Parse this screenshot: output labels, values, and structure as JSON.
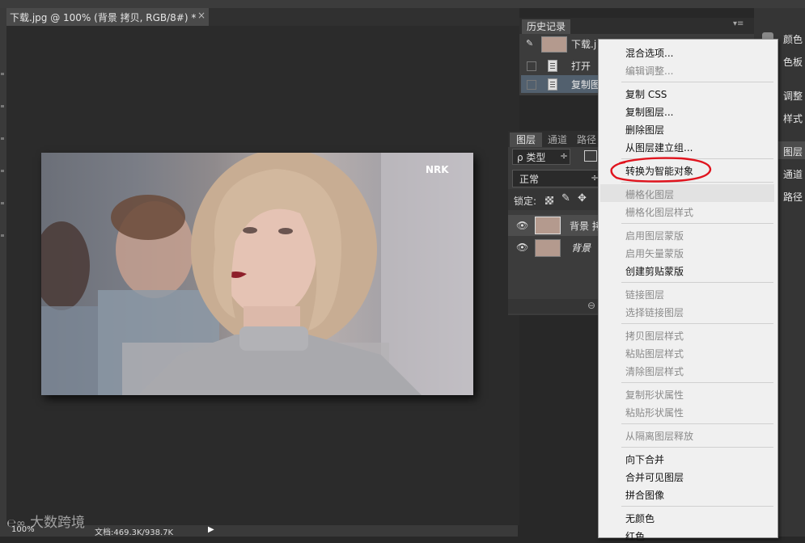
{
  "document": {
    "tab_title": "下载.jpg @ 100% (背景 拷贝, RGB/8#) *",
    "close_glyph": "×",
    "image_logo": "NRK"
  },
  "status": {
    "zoom": "100%",
    "doc_size": "文档:469.3K/938.7K",
    "arrow": "▶"
  },
  "history": {
    "tab": "历史记录",
    "menu_glyph": "▾≡",
    "items": [
      {
        "label": "下载.j"
      },
      {
        "label": "打开"
      },
      {
        "label": "复制图"
      }
    ]
  },
  "layers": {
    "tabs": [
      "图层",
      "通道",
      "路径"
    ],
    "filter_label": "ρ 类型",
    "filter_arrow": "÷",
    "blend_mode": "正常",
    "lock_label": "锁定:",
    "rows": [
      {
        "name": "背景 拷"
      },
      {
        "name": "背景"
      }
    ],
    "link_glyph": "⊖"
  },
  "right_panel": {
    "items": [
      "颜色",
      "色板",
      "调整",
      "样式",
      "图层",
      "通道",
      "路径"
    ]
  },
  "context_menu": {
    "items": [
      {
        "label": "混合选项...",
        "enabled": true
      },
      {
        "label": "编辑调整...",
        "enabled": false
      },
      {
        "label": "复制 CSS",
        "enabled": true
      },
      {
        "label": "复制图层...",
        "enabled": true
      },
      {
        "label": "删除图层",
        "enabled": true
      },
      {
        "label": "从图层建立组...",
        "enabled": true
      },
      {
        "label": "转换为智能对象",
        "enabled": true
      },
      {
        "label": "栅格化图层",
        "enabled": false
      },
      {
        "label": "栅格化图层样式",
        "enabled": false
      },
      {
        "label": "启用图层蒙版",
        "enabled": false
      },
      {
        "label": "启用矢量蒙版",
        "enabled": false
      },
      {
        "label": "创建剪贴蒙版",
        "enabled": true
      },
      {
        "label": "链接图层",
        "enabled": false
      },
      {
        "label": "选择链接图层",
        "enabled": false
      },
      {
        "label": "拷贝图层样式",
        "enabled": false
      },
      {
        "label": "粘贴图层样式",
        "enabled": false
      },
      {
        "label": "清除图层样式",
        "enabled": false
      },
      {
        "label": "复制形状属性",
        "enabled": false
      },
      {
        "label": "粘贴形状属性",
        "enabled": false
      },
      {
        "label": "从隔离图层释放",
        "enabled": false
      },
      {
        "label": "向下合并",
        "enabled": true
      },
      {
        "label": "合并可见图层",
        "enabled": true
      },
      {
        "label": "拼合图像",
        "enabled": true
      },
      {
        "label": "无颜色",
        "enabled": true
      },
      {
        "label": "红色",
        "enabled": true
      }
    ],
    "highlighted": "栅格化图层",
    "annotated": "转换为智能对象",
    "annotation_color": "#e0141e"
  },
  "watermark": {
    "text": "大数跨境"
  }
}
